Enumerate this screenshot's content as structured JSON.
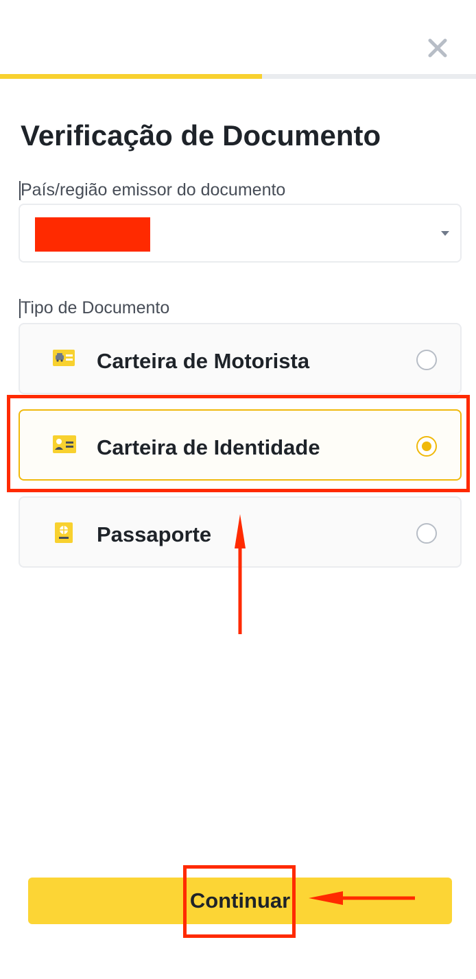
{
  "header": {
    "close_icon": "close-icon",
    "progress_fraction": 0.55
  },
  "page": {
    "title": "Verificação de Documento"
  },
  "country": {
    "label": "País/região emissor do documento",
    "selected_value": "",
    "arrow_icon": "caret-down-icon"
  },
  "document_type": {
    "label": "Tipo de Documento",
    "options": [
      {
        "label": "Carteira de Motorista",
        "icon": "driver-license-icon",
        "selected": false
      },
      {
        "label": "Carteira de Identidade",
        "icon": "id-card-icon",
        "selected": true
      },
      {
        "label": "Passaporte",
        "icon": "passport-icon",
        "selected": false
      }
    ]
  },
  "footer": {
    "continue_label": "Continuar"
  },
  "colors": {
    "accent": "#fcd535",
    "selected_border": "#f0b90b",
    "annotation": "#ff2a00",
    "text": "#1e2329"
  }
}
